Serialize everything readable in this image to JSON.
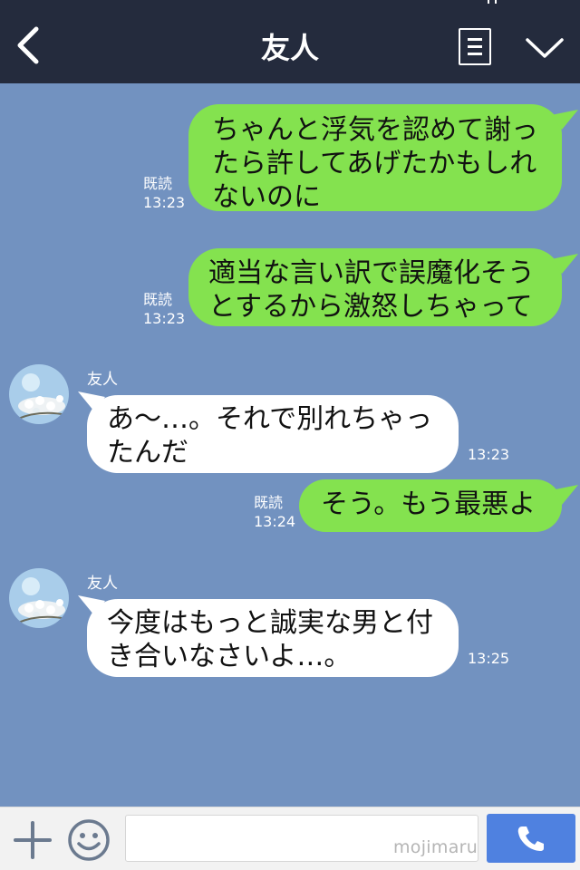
{
  "header": {
    "title": "友人",
    "back_icon": "chevron-left-icon",
    "menu_icon": "list-icon",
    "expand_icon": "chevron-down-icon"
  },
  "messages": [
    {
      "side": "sent",
      "text_lines": [
        "ちゃんと浮気を認めて謝っ",
        "たら許してあげたかもしれ",
        "ないのに"
      ],
      "read_label": "既読",
      "time": "13:23"
    },
    {
      "side": "sent",
      "text_lines": [
        "適当な言い訳で誤魔化そう",
        "とするから激怒しちゃって"
      ],
      "read_label": "既読",
      "time": "13:23"
    },
    {
      "side": "received",
      "sender": "友人",
      "text_lines": [
        "あ〜…。それで別れちゃっ",
        "たんだ"
      ],
      "time": "13:23"
    },
    {
      "side": "sent",
      "text_lines": [
        "そう。もう最悪よ"
      ],
      "read_label": "既読",
      "time": "13:24"
    },
    {
      "side": "received",
      "sender": "友人",
      "text_lines": [
        "今度はもっと誠実な男と付",
        "き合いなさいよ…。"
      ],
      "time": "13:25"
    }
  ],
  "input_bar": {
    "plus_icon": "plus-icon",
    "sticker_icon": "smiley-icon",
    "input_value": "",
    "call_icon": "phone-icon"
  },
  "watermark": "mojimaru",
  "colors": {
    "header_bg": "#242b3d",
    "chat_bg": "#7292c0",
    "sent_bubble": "#84e24f",
    "received_bubble": "#ffffff",
    "call_button": "#4f81e0"
  }
}
